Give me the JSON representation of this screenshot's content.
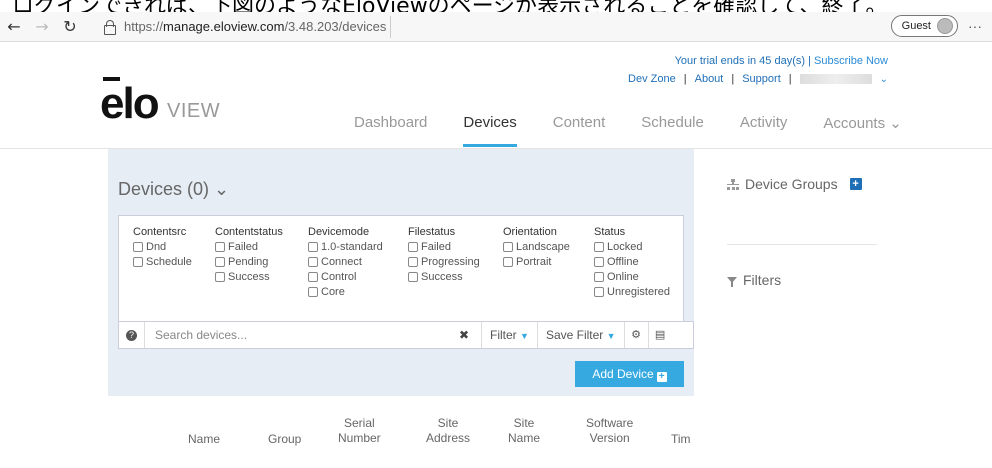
{
  "caption": "ログインできれば、下図のようなEloViewのページが表示されることを確認して、終了。",
  "browser": {
    "url_prefix": "https://",
    "url_host": "manage.eloview.com",
    "url_path": "/3.48.203/devices",
    "profile_label": "Guest"
  },
  "header": {
    "logo_text": "elo",
    "logo_view": "VIEW",
    "trial_text": "Your trial ends in 45 day(s) |",
    "subscribe_label": "Subscribe Now",
    "links": [
      "Dev Zone",
      "About",
      "Support"
    ]
  },
  "nav": {
    "items": [
      "Dashboard",
      "Devices",
      "Content",
      "Schedule",
      "Activity",
      "Accounts ⌄"
    ],
    "active": "Devices"
  },
  "devices": {
    "title": "Devices (0) ⌄",
    "filters": [
      {
        "heading": "Contentsrc",
        "options": [
          "Dnd",
          "Schedule"
        ]
      },
      {
        "heading": "Contentstatus",
        "options": [
          "Failed",
          "Pending",
          "Success"
        ]
      },
      {
        "heading": "Devicemode",
        "options": [
          "1.0-standard",
          "Connect",
          "Control",
          "Core"
        ]
      },
      {
        "heading": "Filestatus",
        "options": [
          "Failed",
          "Progressing",
          "Success"
        ]
      },
      {
        "heading": "Orientation",
        "options": [
          "Landscape",
          "Portrait"
        ]
      },
      {
        "heading": "Status",
        "options": [
          "Locked",
          "Offline",
          "Online",
          "Unregistered"
        ]
      }
    ],
    "search_placeholder": "Search devices...",
    "filter_label": "Filter",
    "save_filter_label": "Save Filter",
    "add_device_label": "Add Device",
    "columns": [
      "Name",
      "Group",
      "Serial\nNumber",
      "Site\nAddress",
      "Site\nName",
      "Software\nVersion",
      "Tim"
    ]
  },
  "sidebar": {
    "device_groups_label": "Device Groups",
    "filters_label": "Filters"
  }
}
